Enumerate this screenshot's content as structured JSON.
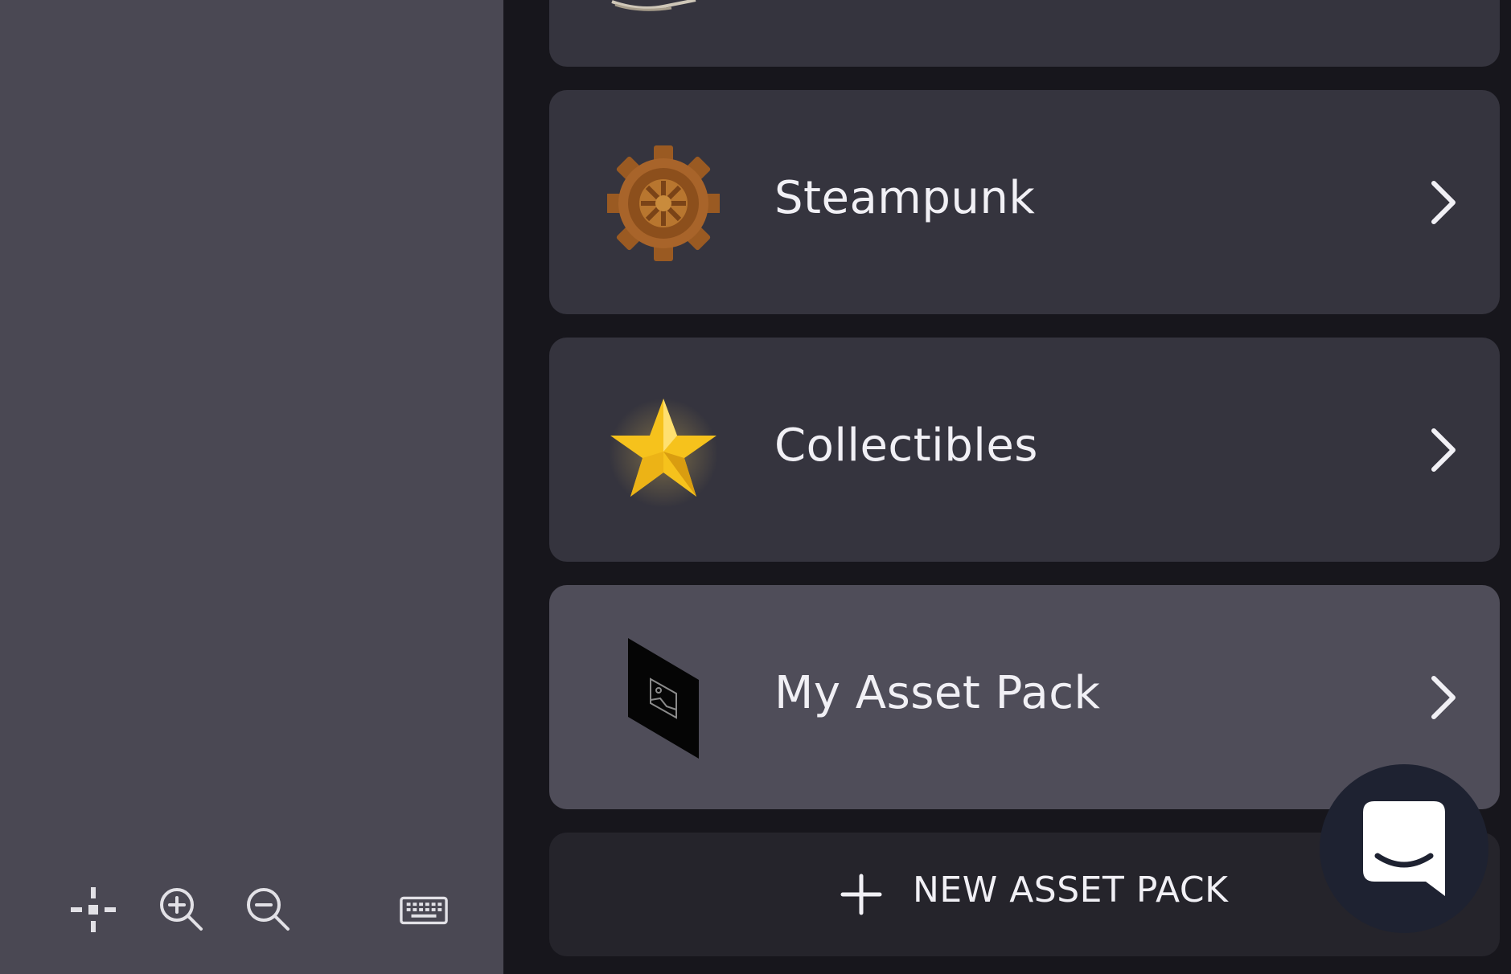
{
  "toolbar": {
    "tools": [
      {
        "name": "move-tool",
        "icon": "move-crosshair-icon"
      },
      {
        "name": "zoom-in",
        "icon": "zoom-in-icon"
      },
      {
        "name": "zoom-out",
        "icon": "zoom-out-icon"
      },
      {
        "name": "keyboard",
        "icon": "keyboard-icon"
      }
    ]
  },
  "asset_packs": [
    {
      "label": "Steampunk",
      "icon": "gear-icon"
    },
    {
      "label": "Collectibles",
      "icon": "star-icon"
    },
    {
      "label": "My Asset Pack",
      "icon": "image-placeholder-icon"
    }
  ],
  "new_pack": {
    "label": "NEW ASSET PACK",
    "icon": "plus-icon"
  },
  "chat": {
    "icon": "chat-smile-icon"
  },
  "colors": {
    "left_panel": "#4a4853",
    "right_panel": "#17161c",
    "card": "#35343e",
    "card_highlight": "#4f4d59",
    "new_pack_bg": "#25242b",
    "chat_bubble": "#1e2231",
    "text": "#f1f0f5"
  }
}
